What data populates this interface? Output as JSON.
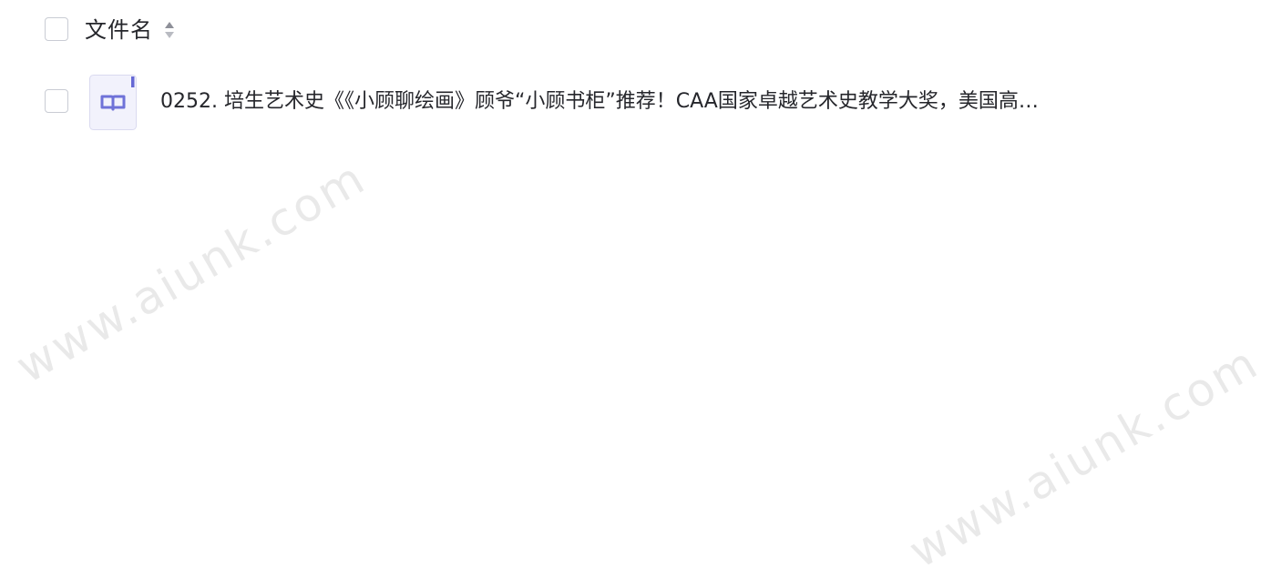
{
  "header": {
    "column_label": "文件名",
    "sort_icon": "sort-up-down-icon"
  },
  "files": [
    {
      "name": "0252. 培生艺术史《《小顾聊绘画》顾爷“小顾书柜”推荐！CAA国家卓越艺术史教学大奖，美国高…",
      "icon": "book-file-icon",
      "checked": false
    }
  ],
  "watermark": "www.aiunk.com",
  "colors": {
    "icon_accent": "#7274d6",
    "icon_background": "#f2f2fc",
    "checkbox_border": "#c9ccd4",
    "text": "#25262b"
  }
}
